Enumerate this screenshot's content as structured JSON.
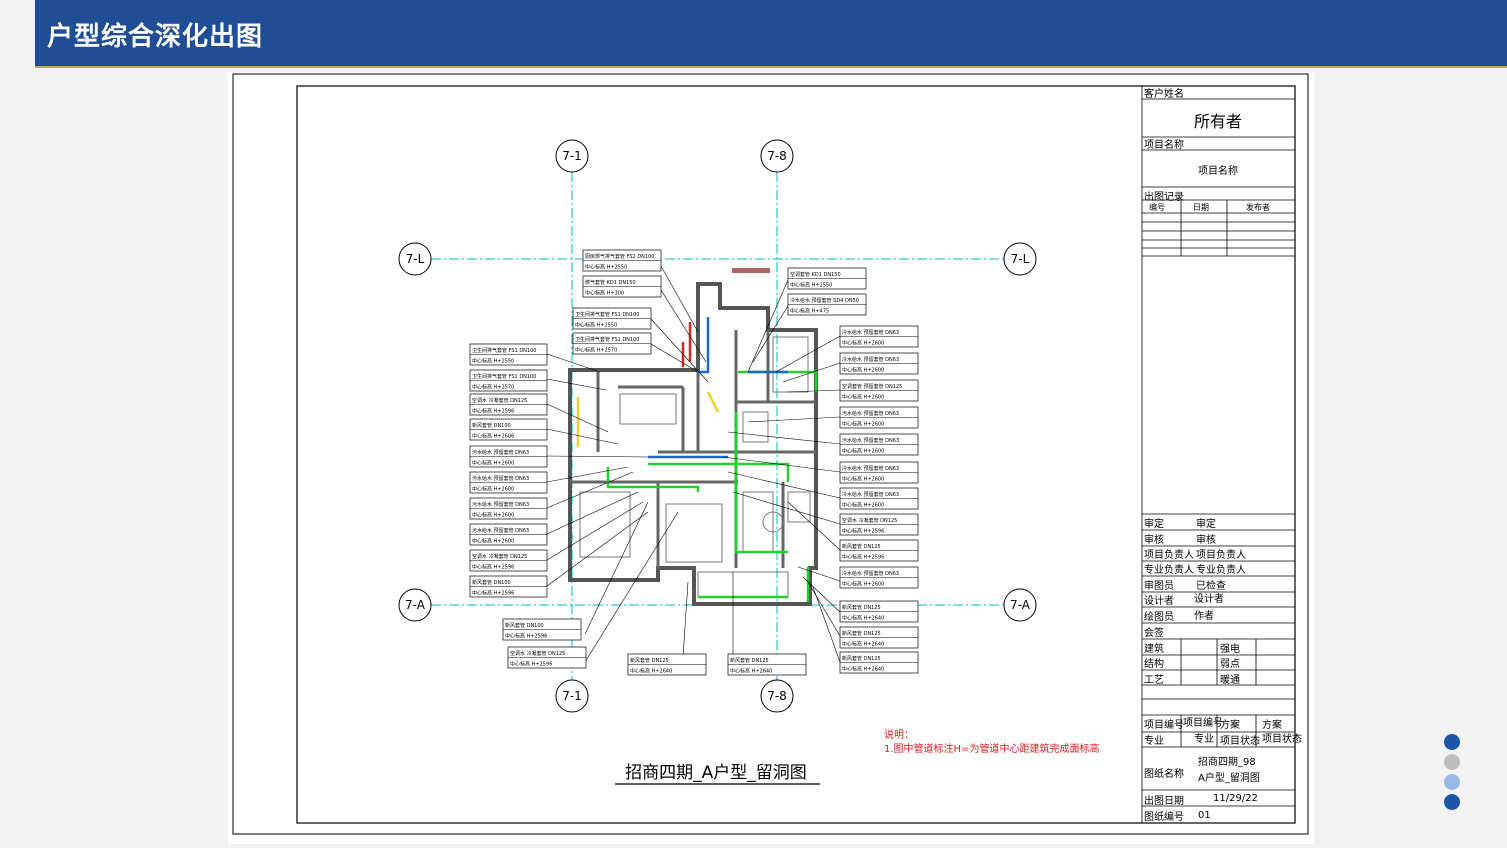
{
  "header": {
    "title": "户型综合深化出图"
  },
  "drawing": {
    "title": "招商四期_A户型_留洞图",
    "note_title": "说明：",
    "note_line1": "1.图中管道标注H=为管道中心距建筑完成面标高",
    "axes": {
      "top_left": "7-1",
      "top_right": "7-8",
      "left_top": "7-L",
      "right_top": "7-L",
      "left_bottom": "7-A",
      "right_bottom": "7-A",
      "bottom_left": "7-1",
      "bottom_right": "7-8"
    }
  },
  "title_block": {
    "client_label": "客户姓名",
    "client_value": "所有者",
    "project_label": "项目名称",
    "project_value": "项目名称",
    "issue_label": "出图记录",
    "issue_headers": [
      "编号",
      "日期",
      "发布者"
    ],
    "roles": [
      {
        "label": "审定",
        "value": "审定"
      },
      {
        "label": "审核",
        "value": "审核"
      },
      {
        "label": "项目负责人",
        "value": "项目负责人"
      },
      {
        "label": "专业负责人",
        "value": "专业负责人"
      },
      {
        "label": "审图员",
        "value": "已检查"
      },
      {
        "label": "设计者",
        "value": "设计者"
      },
      {
        "label": "绘图员",
        "value": "作者"
      }
    ],
    "countersign_label": "会签",
    "countersign": [
      {
        "left": "建筑",
        "right": "强电"
      },
      {
        "left": "结构",
        "right": "弱点"
      },
      {
        "left": "工艺",
        "right": "暖通"
      }
    ],
    "project_no_label": "项目编号",
    "project_no_value": "项目编号",
    "scheme_label": "方案",
    "scheme_value": "方案",
    "discipline_label": "专业",
    "discipline_value": "专业",
    "status_label": "项目状态",
    "status_value": "项目状态",
    "drawing_name_label": "图纸名称",
    "drawing_name_line1": "招商四期_98",
    "drawing_name_line2": "A户型_留洞图",
    "date_label": "出图日期",
    "date_value": "11/29/22",
    "sheet_no_label": "图纸编号",
    "sheet_no_value": "01"
  },
  "tags": {
    "left": [
      {
        "l1": "卫生间排气套管 FS1 DN100",
        "l2": "中心标高 H+2550"
      },
      {
        "l1": "卫生间排气套管 FS1 DN100",
        "l2": "中心标高 H+2570"
      },
      {
        "l1": "空调水 冷凝套管 DN125",
        "l2": "中心标高 H+2596"
      },
      {
        "l1": "新风套管 DN100",
        "l2": "中心标高 H+2606"
      },
      {
        "l1": "污水给水 预留套管 DN63",
        "l2": "中心标高 H+2600"
      },
      {
        "l1": "污水给水 预留套管 DN63",
        "l2": "中心标高 H+2600"
      },
      {
        "l1": "污水给水 预留套管 DN63",
        "l2": "中心标高 H+2600"
      },
      {
        "l1": "污水给水 预留套管 DN63",
        "l2": "中心标高 H+2600"
      },
      {
        "l1": "空调水 冷凝套管 DN125",
        "l2": "中心标高 H+2596"
      },
      {
        "l1": "新风套管 DN100",
        "l2": "中心标高 H+2596"
      }
    ],
    "top": [
      {
        "l1": "厨房燃气排气套管 FS2 DN100",
        "l2": "中心标高 H+2550"
      },
      {
        "l1": "燃气套管 KD1 DN150",
        "l2": "中心标高 H+300"
      },
      {
        "l1": "卫生间排气套管 FS1 DN100",
        "l2": "中心标高 H+2550"
      },
      {
        "l1": "卫生间排气套管 FS1 DN100",
        "l2": "中心标高 H+2570"
      }
    ],
    "right": [
      {
        "l1": "空调套管 KD1 DN150",
        "l2": "中心标高 H+2550"
      },
      {
        "l1": "冷水给水 预留套管 SD4 DN50",
        "l2": "中心标高 H+475"
      },
      {
        "l1": "冷水给水 预留套管 DN63",
        "l2": "中心标高 H+2600"
      },
      {
        "l1": "冷水给水 预留套管 DN63",
        "l2": "中心标高 H+2600"
      },
      {
        "l1": "空调套管 预留套管 DN125",
        "l2": "中心标高 H+2600"
      },
      {
        "l1": "污水给水 预留套管 DN63",
        "l2": "中心标高 H+2600"
      },
      {
        "l1": "污水给水 预留套管 DN63",
        "l2": "中心标高 H+2600"
      },
      {
        "l1": "冷水给水 预留套管 DN63",
        "l2": "中心标高 H+2600"
      },
      {
        "l1": "冷水给水 预留套管 DN63",
        "l2": "中心标高 H+2600"
      },
      {
        "l1": "空调水 冷凝套管 DN125",
        "l2": "中心标高 H+2596"
      },
      {
        "l1": "新风套管 DN125",
        "l2": "中心标高 H+2596"
      },
      {
        "l1": "冷水给水 预留套管 DN63",
        "l2": "中心标高 H+2600"
      },
      {
        "l1": "新风套管 DN125",
        "l2": "中心标高 H+2640"
      },
      {
        "l1": "新风套管 DN125",
        "l2": "中心标高 H+2640"
      },
      {
        "l1": "新风套管 DN125",
        "l2": "中心标高 H+2640"
      }
    ],
    "bottom": [
      {
        "l1": "新风套管 DN100",
        "l2": "中心标高 H+2596"
      },
      {
        "l1": "空调水 冷凝套管 DN125",
        "l2": "中心标高 H+2596"
      },
      {
        "l1": "新风套管 DN125",
        "l2": "中心标高 H+2640"
      },
      {
        "l1": "新风套管 DN125",
        "l2": "中心标高 H+2640"
      }
    ]
  },
  "colors": {
    "header_bg": "#1f4e96",
    "axis_line": "#00b8c8",
    "note_red": "#d42020"
  },
  "nav_dots": [
    "#1f55a8",
    "#bdbdbd",
    "#9ab8e6",
    "#1f55a8"
  ]
}
